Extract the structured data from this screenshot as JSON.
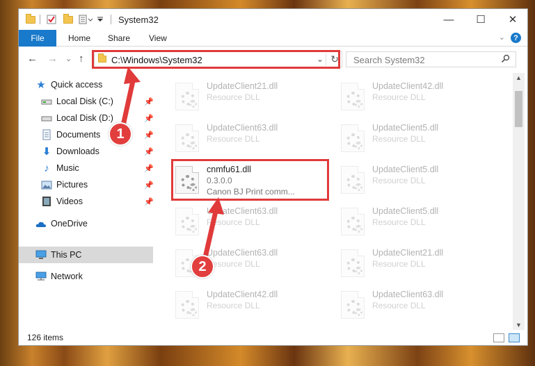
{
  "window": {
    "title": "System32",
    "minimize_glyph": "—",
    "maximize_glyph": "☐",
    "close_glyph": "✕"
  },
  "ribbon": {
    "file_label": "File",
    "tabs": [
      "Home",
      "Share",
      "View"
    ],
    "help_glyph": "?",
    "collapse_glyph": "⌄"
  },
  "nav": {
    "back_glyph": "←",
    "forward_glyph": "→",
    "recent_glyph": "⌄",
    "up_glyph": "↑",
    "address": "C:\\Windows\\System32",
    "refresh_glyph": "↻",
    "dropdown_glyph": "⌄",
    "search_placeholder": "Search System32",
    "search_icon": "search-icon"
  },
  "sidebar": {
    "items": [
      {
        "label": "Quick access",
        "icon": "star-icon",
        "pinned": false
      },
      {
        "label": "Local Disk (C:)",
        "icon": "drive-icon",
        "pinned": true
      },
      {
        "label": "Local Disk (D:)",
        "icon": "drive-icon",
        "pinned": true
      },
      {
        "label": "Documents",
        "icon": "documents-icon",
        "pinned": true
      },
      {
        "label": "Downloads",
        "icon": "download-icon",
        "pinned": true
      },
      {
        "label": "Music",
        "icon": "music-icon",
        "pinned": true
      },
      {
        "label": "Pictures",
        "icon": "pictures-icon",
        "pinned": true
      },
      {
        "label": "Videos",
        "icon": "videos-icon",
        "pinned": true
      },
      {
        "label": "OneDrive",
        "icon": "cloud-icon",
        "pinned": false
      },
      {
        "label": "This PC",
        "icon": "pc-icon",
        "pinned": false,
        "selected": true
      },
      {
        "label": "Network",
        "icon": "network-icon",
        "pinned": false
      }
    ]
  },
  "files": [
    {
      "name": "UpdateClient21.dll",
      "sub": "Resource DLL"
    },
    {
      "name": "UpdateClient42.dll",
      "sub": "Resource DLL"
    },
    {
      "name": "UpdateClient63.dll",
      "sub": "Resource DLL"
    },
    {
      "name": "UpdateClient5.dll",
      "sub": "Resource DLL"
    },
    {
      "name": "cnmfu61.dll",
      "sub": "0.3.0.0",
      "sub2": "Canon BJ Print comm...",
      "highlighted": true
    },
    {
      "name": "UpdateClient5.dll",
      "sub": "Resource DLL"
    },
    {
      "name": "UpdateClient63.dll",
      "sub": "Resource DLL"
    },
    {
      "name": "UpdateClient5.dll",
      "sub": "Resource DLL"
    },
    {
      "name": "UpdateClient63.dll",
      "sub": "Resource DLL"
    },
    {
      "name": "UpdateClient21.dll",
      "sub": "Resource DLL"
    },
    {
      "name": "UpdateClient42.dll",
      "sub": "Resource DLL"
    },
    {
      "name": "UpdateClient63.dll",
      "sub": "Resource DLL"
    }
  ],
  "status": {
    "count": "126 items"
  },
  "callouts": {
    "one": "1",
    "two": "2"
  },
  "colors": {
    "accent": "#1979ca",
    "callout": "#e03a3a"
  }
}
